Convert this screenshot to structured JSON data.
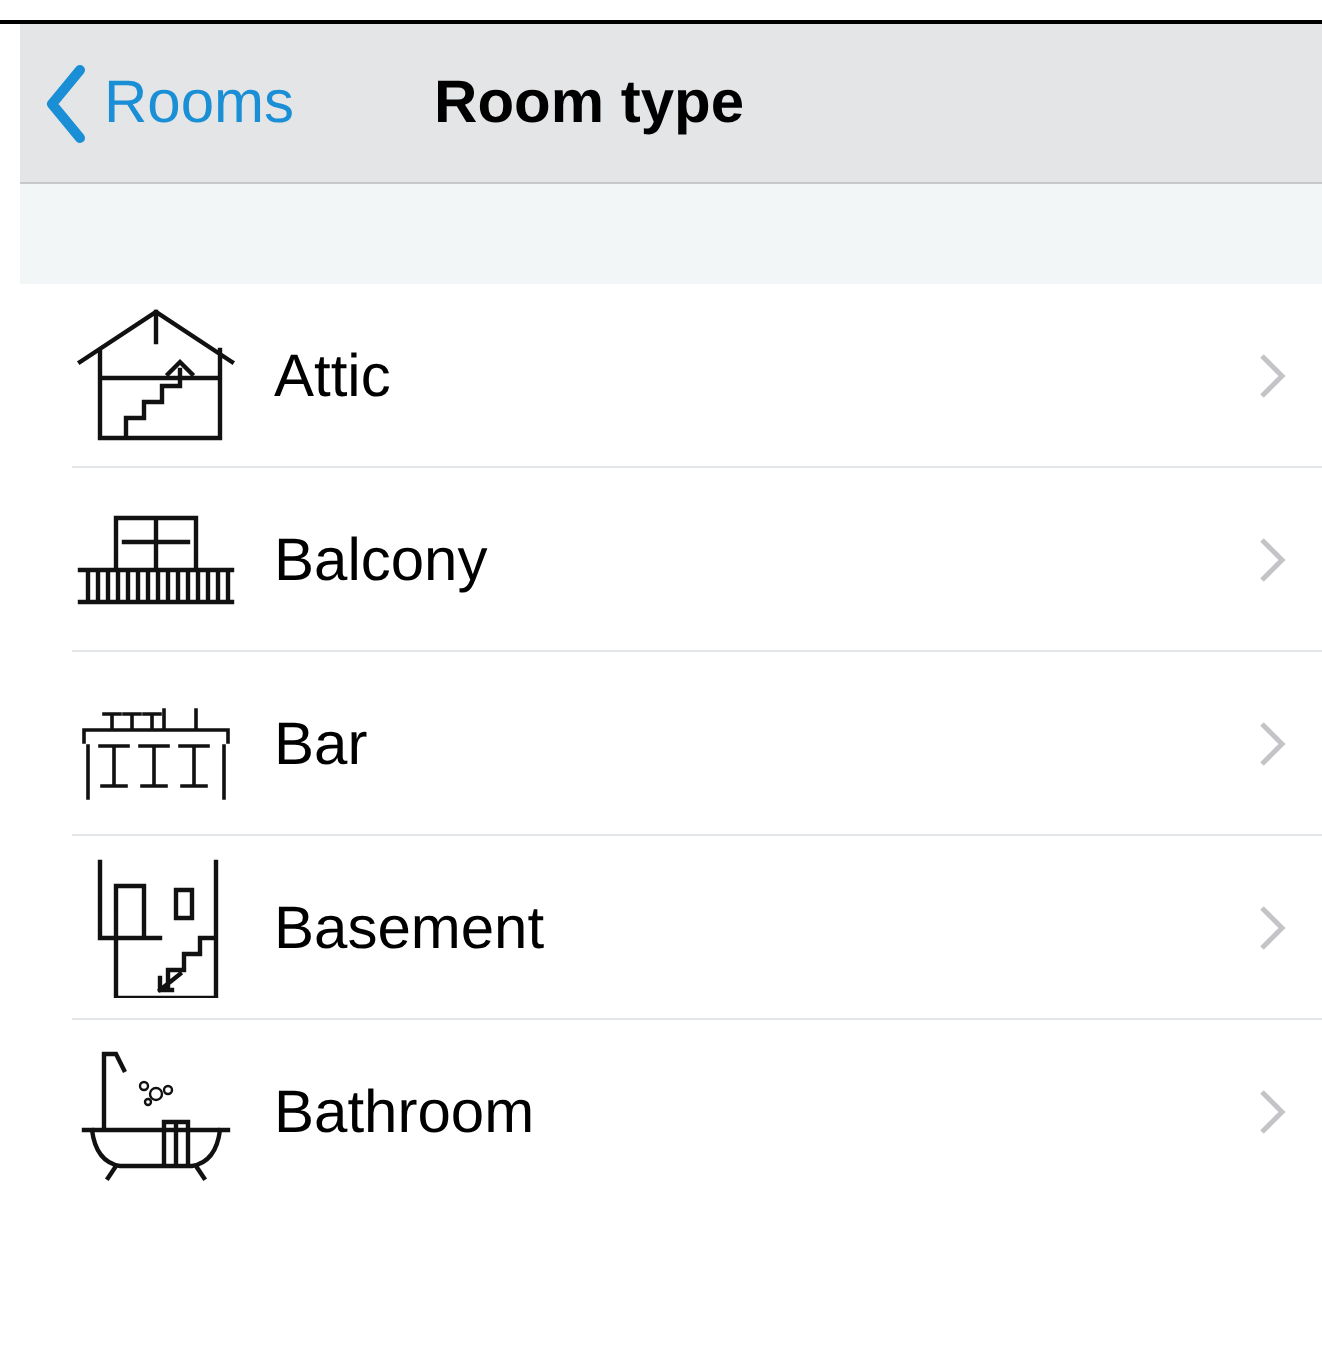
{
  "nav_bar": {
    "back_label": "Rooms",
    "title": "Room type"
  },
  "room_types": [
    {
      "kind": "attic",
      "label": "Attic"
    },
    {
      "kind": "balcony",
      "label": "Balcony"
    },
    {
      "kind": "bar",
      "label": "Bar"
    },
    {
      "kind": "basement",
      "label": "Basement"
    },
    {
      "kind": "bathroom",
      "label": "Bathroom"
    }
  ]
}
